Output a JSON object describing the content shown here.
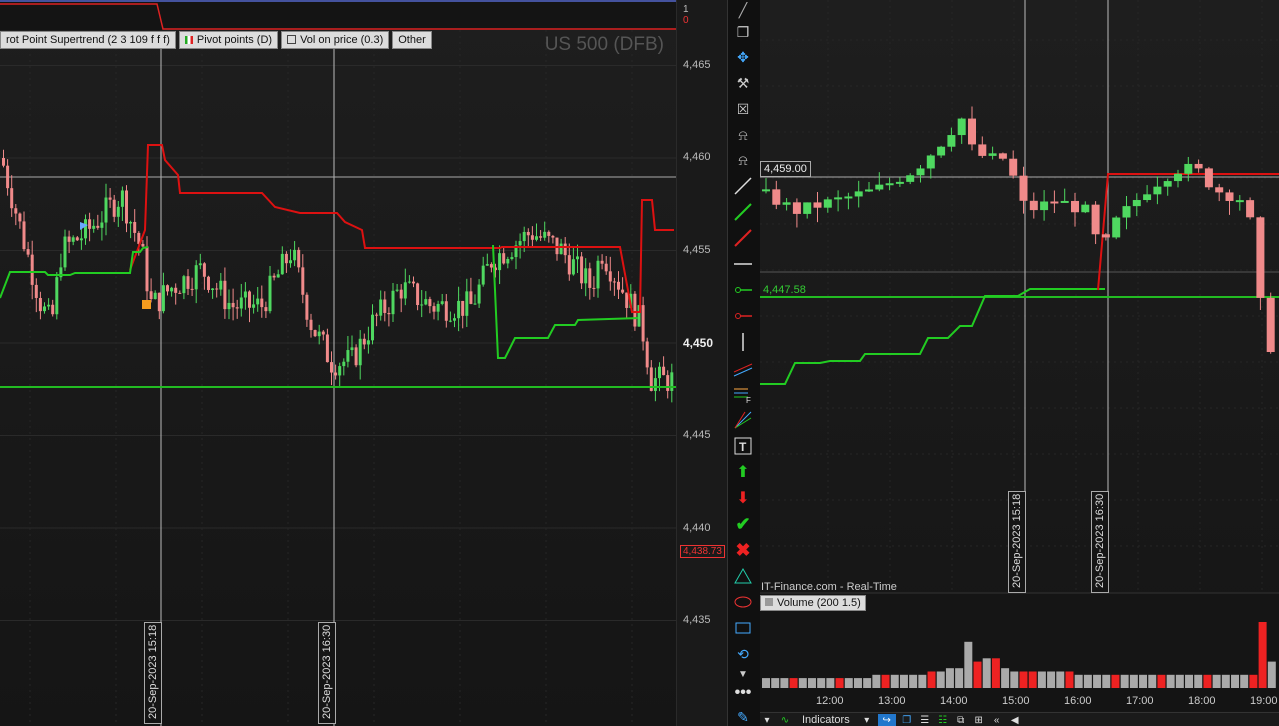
{
  "left_chart": {
    "indicators": [
      {
        "label": "rot Point Supertrend (2 3 109 f f f)"
      },
      {
        "label": "Pivot points (D)"
      },
      {
        "label": "Vol on price (0.3)"
      },
      {
        "label": "Other"
      }
    ],
    "watermark": "US 500 (DFB)",
    "axis_labels": [
      "4,465",
      "4,460",
      "4,455",
      "4,450",
      "4,445",
      "4,440",
      "4,435"
    ],
    "current_price": "4,438.73",
    "top_axis_markers": [
      "1",
      "0"
    ],
    "crosshair_dates": [
      "20-Sep-2023 15:18",
      "20-Sep-2023 16:30"
    ]
  },
  "right_chart": {
    "price_labels": [
      "4,459.00",
      "4,447.58"
    ],
    "crosshair_dates": [
      "20-Sep-2023 15:18",
      "20-Sep-2023 16:30"
    ],
    "source": "IT-Finance.com - Real-Time",
    "volume_label": "Volume (200 1.5)",
    "time_axis": [
      "12:00",
      "13:00",
      "14:00",
      "15:00",
      "16:00",
      "17:00",
      "18:00",
      "19:00"
    ],
    "bottom_bar": {
      "indicators_label": "Indicators"
    }
  },
  "colors": {
    "up": "#4fd860",
    "down": "#f08a8a",
    "supertrend_up": "#22cc22",
    "supertrend_down": "#dd1111",
    "pivot": "#22bb22",
    "volume_up": "#aaaaaa",
    "volume_down": "#ee2222"
  },
  "chart_data": [
    {
      "type": "line",
      "title": "US 500 (DFB)",
      "xlabel": "",
      "ylabel": "",
      "ylim": [
        4433,
        4467
      ],
      "series": [
        {
          "values": [
            4452,
            4452,
            4455,
            4455,
            4460.5,
            4459,
            4458,
            4458,
            4457,
            4456,
            4455,
            4455,
            4455,
            4455
          ]
        },
        {
          "values": [
            4452,
            4453,
            4455,
            4455,
            4455,
            4454,
            4455,
            4455,
            4455,
            4449,
            4450,
            4451,
            4451,
            4451
          ]
        }
      ],
      "x": [
        "",
        "",
        "",
        "",
        "",
        "",
        "",
        "",
        "",
        "",
        "",
        "",
        "",
        ""
      ]
    },
    {
      "type": "line",
      "ylim": [
        4435,
        4465
      ],
      "series": [
        {
          "values": [
            4444,
            4445,
            4445,
            4445,
            4446,
            4447,
            4448,
            4448,
            4448.5,
            4450,
            4459,
            4459,
            4459
          ]
        }
      ]
    },
    {
      "type": "bar",
      "series": [
        {
          "values": [
            3,
            3,
            3,
            3,
            3,
            3,
            3,
            3,
            3,
            3,
            3,
            3,
            4,
            4,
            4,
            4,
            4,
            4,
            5,
            5,
            6,
            6,
            14,
            8,
            9,
            9,
            6,
            5,
            5,
            5,
            5,
            5,
            5,
            5,
            4,
            4,
            4,
            4,
            4,
            4,
            4,
            4,
            4,
            4,
            4,
            4,
            4,
            4,
            4,
            4,
            4,
            4,
            4,
            4,
            20,
            8
          ]
        }
      ]
    }
  ]
}
